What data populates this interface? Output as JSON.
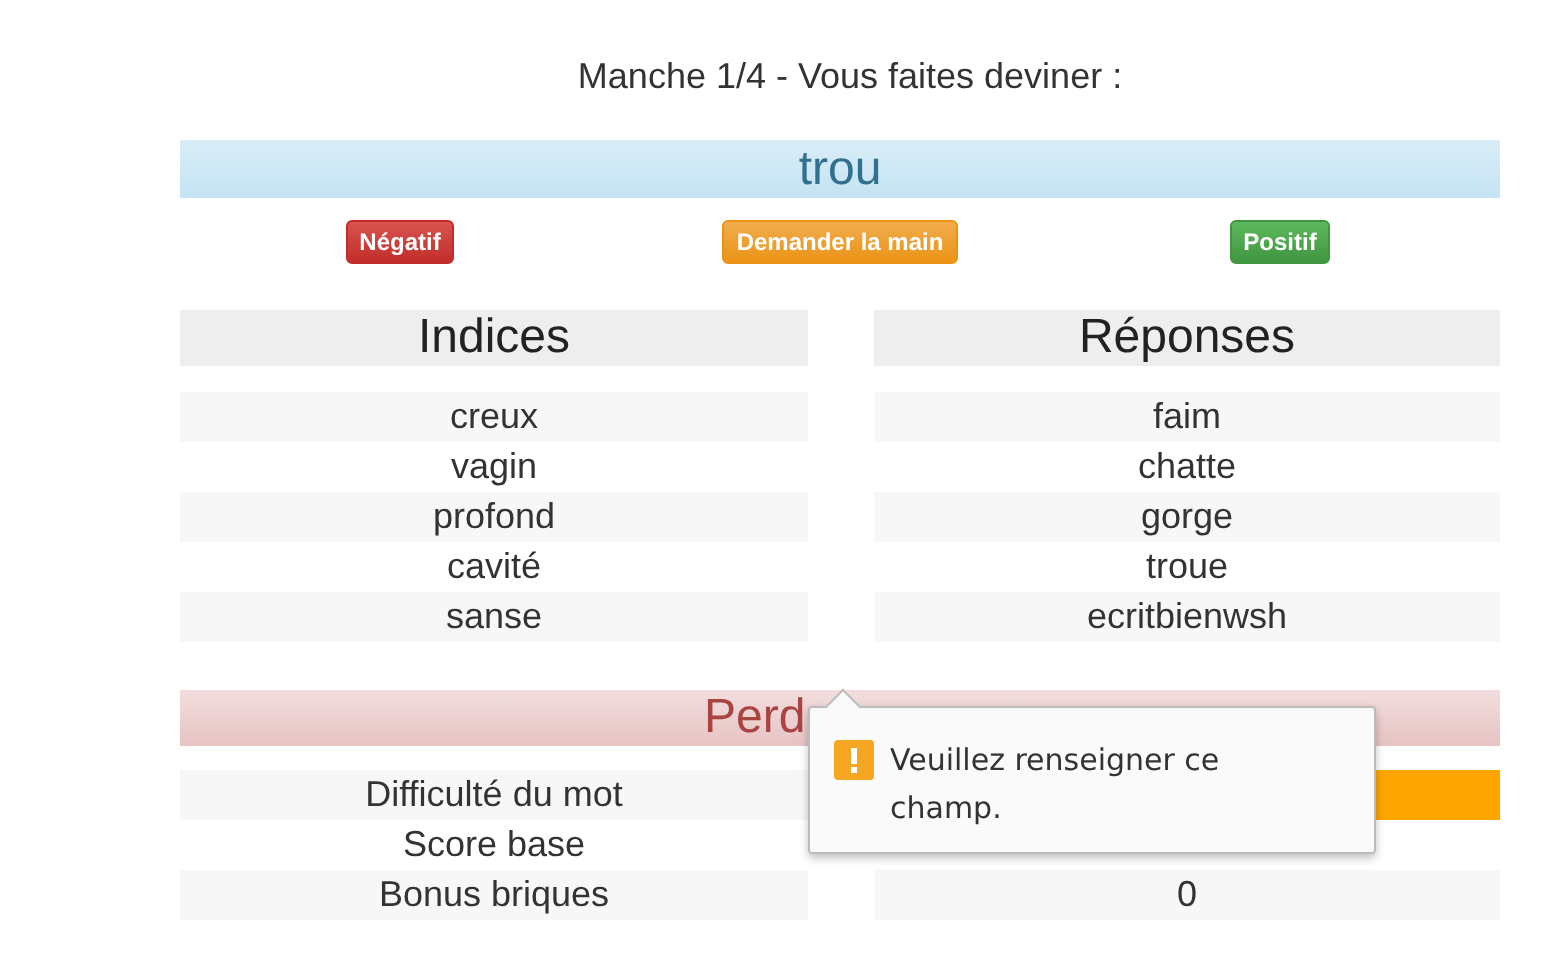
{
  "round_title": "Manche 1/4 - Vous faites deviner :",
  "word": "trou",
  "buttons": [
    {
      "label": "Négatif",
      "kind": "danger"
    },
    {
      "label": "Demander la main",
      "kind": "warning"
    },
    {
      "label": "Positif",
      "kind": "success"
    }
  ],
  "clues": {
    "heading": "Indices",
    "items": [
      "creux",
      "vagin",
      "profond",
      "cavité",
      "sanse"
    ]
  },
  "answers": {
    "heading": "Réponses",
    "items": [
      "faim",
      "chatte",
      "gorge",
      "troue",
      "ecritbienwsh"
    ]
  },
  "result_banner": "Perd",
  "stats": [
    {
      "label": "Difficulté du mot",
      "kind": "meter",
      "level": 1
    },
    {
      "label": "Score base",
      "kind": "text"
    },
    {
      "label": "Bonus briques",
      "kind": "text",
      "value": "0"
    }
  ],
  "tooltip": {
    "message": "Veuillez renseigner ce champ."
  }
}
